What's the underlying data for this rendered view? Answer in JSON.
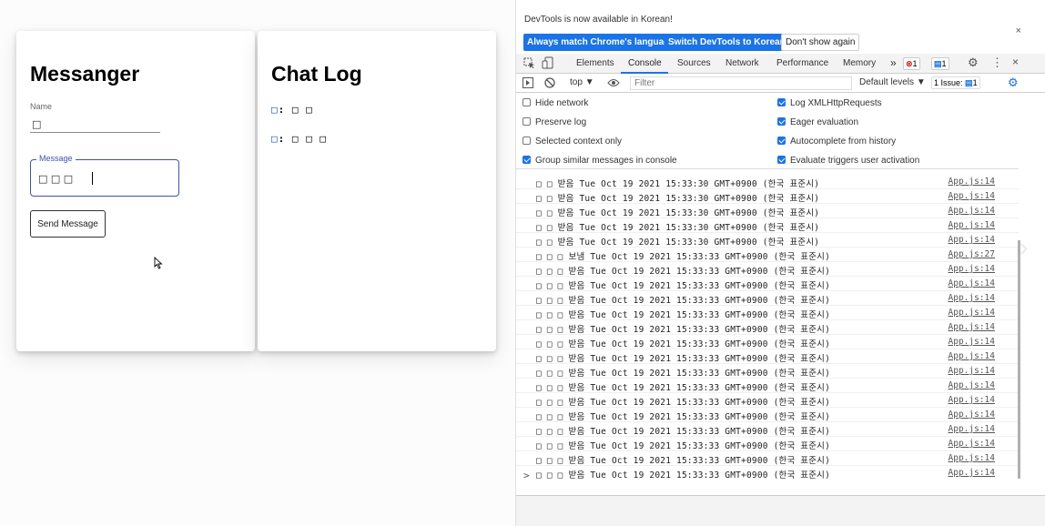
{
  "app": {
    "left_title": "Messanger",
    "right_title": "Chat Log",
    "name_label": "Name",
    "name_value": "□",
    "message_label": "Message",
    "message_value": "□ □ □",
    "send_label": "Send Message",
    "log": [
      {
        "who": "□",
        "sep": ":",
        "text": "□ □"
      },
      {
        "who": "□",
        "sep": ":",
        "text": "□ □ □"
      }
    ]
  },
  "devtools": {
    "banner_text": "DevTools is now available in Korean!",
    "banner_buttons": [
      "Always match Chrome's language",
      "Switch DevTools to Korean",
      "Don't show again"
    ],
    "tabs": [
      "Elements",
      "Console",
      "Sources",
      "Network",
      "Performance",
      "Memory"
    ],
    "active_tab": "Console",
    "more_tabs": "»",
    "error_count": "1",
    "message_count": "1",
    "context": "top",
    "filter_placeholder": "Filter",
    "levels": "Default levels",
    "issues": "1 Issue:",
    "issues_count": "1",
    "settings_left": [
      {
        "label": "Hide network",
        "checked": false
      },
      {
        "label": "Preserve log",
        "checked": false
      },
      {
        "label": "Selected context only",
        "checked": false
      },
      {
        "label": "Group similar messages in console",
        "checked": true
      }
    ],
    "settings_right": [
      {
        "label": "Log XMLHttpRequests",
        "checked": true
      },
      {
        "label": "Eager evaluation",
        "checked": true
      },
      {
        "label": "Autocomplete from history",
        "checked": true
      },
      {
        "label": "Evaluate triggers user activation",
        "checked": true
      }
    ],
    "console_rows": [
      {
        "text": "□ □  받음 Tue Oct 19 2021 15:33:30 GMT+0900 (한국 표준시)",
        "src": "App.js:14"
      },
      {
        "text": "□ □  받음 Tue Oct 19 2021 15:33:30 GMT+0900 (한국 표준시)",
        "src": "App.js:14"
      },
      {
        "text": "□ □  받음 Tue Oct 19 2021 15:33:30 GMT+0900 (한국 표준시)",
        "src": "App.js:14"
      },
      {
        "text": "□ □  받음 Tue Oct 19 2021 15:33:30 GMT+0900 (한국 표준시)",
        "src": "App.js:14"
      },
      {
        "text": "□ □  받음 Tue Oct 19 2021 15:33:30 GMT+0900 (한국 표준시)",
        "src": "App.js:14"
      },
      {
        "text": "□ □ □  보냄 Tue Oct 19 2021 15:33:33 GMT+0900 (한국 표준시)",
        "src": "App.js:27"
      },
      {
        "text": "□ □ □  받음 Tue Oct 19 2021 15:33:33 GMT+0900 (한국 표준시)",
        "src": "App.js:14"
      },
      {
        "text": "□ □ □  받음 Tue Oct 19 2021 15:33:33 GMT+0900 (한국 표준시)",
        "src": "App.js:14"
      },
      {
        "text": "□ □ □  받음 Tue Oct 19 2021 15:33:33 GMT+0900 (한국 표준시)",
        "src": "App.js:14"
      },
      {
        "text": "□ □ □  받음 Tue Oct 19 2021 15:33:33 GMT+0900 (한국 표준시)",
        "src": "App.js:14"
      },
      {
        "text": "□ □ □  받음 Tue Oct 19 2021 15:33:33 GMT+0900 (한국 표준시)",
        "src": "App.js:14"
      },
      {
        "text": "□ □ □  받음 Tue Oct 19 2021 15:33:33 GMT+0900 (한국 표준시)",
        "src": "App.js:14"
      },
      {
        "text": "□ □ □  받음 Tue Oct 19 2021 15:33:33 GMT+0900 (한국 표준시)",
        "src": "App.js:14"
      },
      {
        "text": "□ □ □  받음 Tue Oct 19 2021 15:33:33 GMT+0900 (한국 표준시)",
        "src": "App.js:14"
      },
      {
        "text": "□ □ □  받음 Tue Oct 19 2021 15:33:33 GMT+0900 (한국 표준시)",
        "src": "App.js:14"
      },
      {
        "text": "□ □ □  받음 Tue Oct 19 2021 15:33:33 GMT+0900 (한국 표준시)",
        "src": "App.js:14"
      },
      {
        "text": "□ □ □  받음 Tue Oct 19 2021 15:33:33 GMT+0900 (한국 표준시)",
        "src": "App.js:14"
      },
      {
        "text": "□ □ □  받음 Tue Oct 19 2021 15:33:33 GMT+0900 (한국 표준시)",
        "src": "App.js:14"
      },
      {
        "text": "□ □ □  받음 Tue Oct 19 2021 15:33:33 GMT+0900 (한국 표준시)",
        "src": "App.js:14"
      },
      {
        "text": "□ □ □  받음 Tue Oct 19 2021 15:33:33 GMT+0900 (한국 표준시)",
        "src": "App.js:14"
      },
      {
        "text": "□ □ □  받음 Tue Oct 19 2021 15:33:33 GMT+0900 (한국 표준시)",
        "src": "App.js:14"
      }
    ],
    "prompt": ">",
    "close_glyph": "×"
  },
  "colors": {
    "accent": "#1a73e8",
    "mui_primary": "#3f51b5",
    "error": "#d93025"
  }
}
